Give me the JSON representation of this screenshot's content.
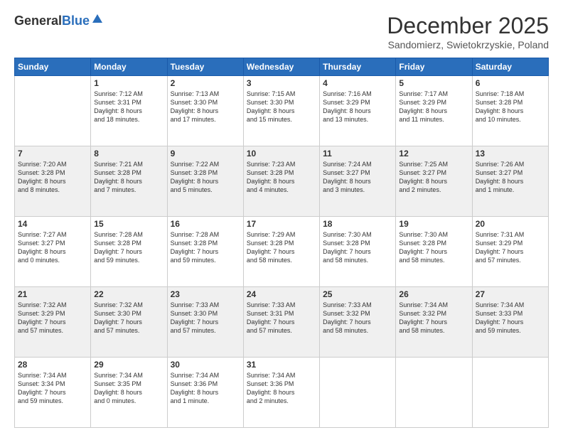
{
  "logo": {
    "general": "General",
    "blue": "Blue"
  },
  "header": {
    "month": "December 2025",
    "location": "Sandomierz, Swietokrzyskie, Poland"
  },
  "days_of_week": [
    "Sunday",
    "Monday",
    "Tuesday",
    "Wednesday",
    "Thursday",
    "Friday",
    "Saturday"
  ],
  "weeks": [
    [
      {
        "day": "",
        "info": ""
      },
      {
        "day": "1",
        "info": "Sunrise: 7:12 AM\nSunset: 3:31 PM\nDaylight: 8 hours\nand 18 minutes."
      },
      {
        "day": "2",
        "info": "Sunrise: 7:13 AM\nSunset: 3:30 PM\nDaylight: 8 hours\nand 17 minutes."
      },
      {
        "day": "3",
        "info": "Sunrise: 7:15 AM\nSunset: 3:30 PM\nDaylight: 8 hours\nand 15 minutes."
      },
      {
        "day": "4",
        "info": "Sunrise: 7:16 AM\nSunset: 3:29 PM\nDaylight: 8 hours\nand 13 minutes."
      },
      {
        "day": "5",
        "info": "Sunrise: 7:17 AM\nSunset: 3:29 PM\nDaylight: 8 hours\nand 11 minutes."
      },
      {
        "day": "6",
        "info": "Sunrise: 7:18 AM\nSunset: 3:28 PM\nDaylight: 8 hours\nand 10 minutes."
      }
    ],
    [
      {
        "day": "7",
        "info": "Sunrise: 7:20 AM\nSunset: 3:28 PM\nDaylight: 8 hours\nand 8 minutes."
      },
      {
        "day": "8",
        "info": "Sunrise: 7:21 AM\nSunset: 3:28 PM\nDaylight: 8 hours\nand 7 minutes."
      },
      {
        "day": "9",
        "info": "Sunrise: 7:22 AM\nSunset: 3:28 PM\nDaylight: 8 hours\nand 5 minutes."
      },
      {
        "day": "10",
        "info": "Sunrise: 7:23 AM\nSunset: 3:28 PM\nDaylight: 8 hours\nand 4 minutes."
      },
      {
        "day": "11",
        "info": "Sunrise: 7:24 AM\nSunset: 3:27 PM\nDaylight: 8 hours\nand 3 minutes."
      },
      {
        "day": "12",
        "info": "Sunrise: 7:25 AM\nSunset: 3:27 PM\nDaylight: 8 hours\nand 2 minutes."
      },
      {
        "day": "13",
        "info": "Sunrise: 7:26 AM\nSunset: 3:27 PM\nDaylight: 8 hours\nand 1 minute."
      }
    ],
    [
      {
        "day": "14",
        "info": "Sunrise: 7:27 AM\nSunset: 3:27 PM\nDaylight: 8 hours\nand 0 minutes."
      },
      {
        "day": "15",
        "info": "Sunrise: 7:28 AM\nSunset: 3:28 PM\nDaylight: 7 hours\nand 59 minutes."
      },
      {
        "day": "16",
        "info": "Sunrise: 7:28 AM\nSunset: 3:28 PM\nDaylight: 7 hours\nand 59 minutes."
      },
      {
        "day": "17",
        "info": "Sunrise: 7:29 AM\nSunset: 3:28 PM\nDaylight: 7 hours\nand 58 minutes."
      },
      {
        "day": "18",
        "info": "Sunrise: 7:30 AM\nSunset: 3:28 PM\nDaylight: 7 hours\nand 58 minutes."
      },
      {
        "day": "19",
        "info": "Sunrise: 7:30 AM\nSunset: 3:28 PM\nDaylight: 7 hours\nand 58 minutes."
      },
      {
        "day": "20",
        "info": "Sunrise: 7:31 AM\nSunset: 3:29 PM\nDaylight: 7 hours\nand 57 minutes."
      }
    ],
    [
      {
        "day": "21",
        "info": "Sunrise: 7:32 AM\nSunset: 3:29 PM\nDaylight: 7 hours\nand 57 minutes."
      },
      {
        "day": "22",
        "info": "Sunrise: 7:32 AM\nSunset: 3:30 PM\nDaylight: 7 hours\nand 57 minutes."
      },
      {
        "day": "23",
        "info": "Sunrise: 7:33 AM\nSunset: 3:30 PM\nDaylight: 7 hours\nand 57 minutes."
      },
      {
        "day": "24",
        "info": "Sunrise: 7:33 AM\nSunset: 3:31 PM\nDaylight: 7 hours\nand 57 minutes."
      },
      {
        "day": "25",
        "info": "Sunrise: 7:33 AM\nSunset: 3:32 PM\nDaylight: 7 hours\nand 58 minutes."
      },
      {
        "day": "26",
        "info": "Sunrise: 7:34 AM\nSunset: 3:32 PM\nDaylight: 7 hours\nand 58 minutes."
      },
      {
        "day": "27",
        "info": "Sunrise: 7:34 AM\nSunset: 3:33 PM\nDaylight: 7 hours\nand 59 minutes."
      }
    ],
    [
      {
        "day": "28",
        "info": "Sunrise: 7:34 AM\nSunset: 3:34 PM\nDaylight: 7 hours\nand 59 minutes."
      },
      {
        "day": "29",
        "info": "Sunrise: 7:34 AM\nSunset: 3:35 PM\nDaylight: 8 hours\nand 0 minutes."
      },
      {
        "day": "30",
        "info": "Sunrise: 7:34 AM\nSunset: 3:36 PM\nDaylight: 8 hours\nand 1 minute."
      },
      {
        "day": "31",
        "info": "Sunrise: 7:34 AM\nSunset: 3:36 PM\nDaylight: 8 hours\nand 2 minutes."
      },
      {
        "day": "",
        "info": ""
      },
      {
        "day": "",
        "info": ""
      },
      {
        "day": "",
        "info": ""
      }
    ]
  ]
}
